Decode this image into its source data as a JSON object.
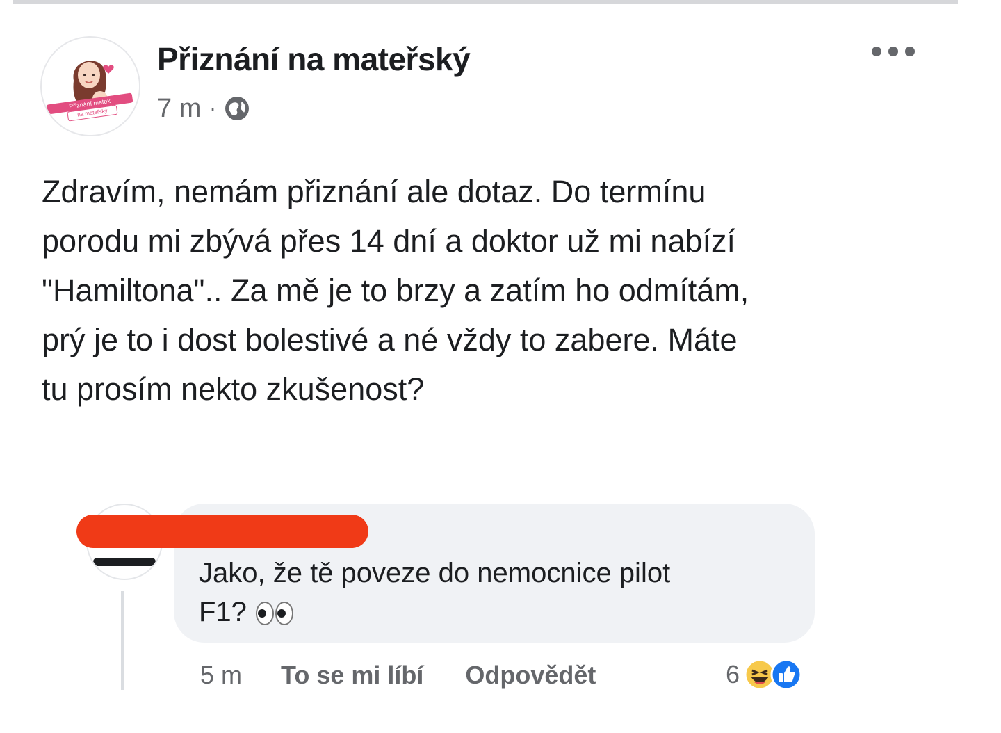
{
  "post": {
    "page_name": "Přiznání na mateřský",
    "time": "7 m",
    "separator": "·",
    "privacy_icon": "globe-icon",
    "more_icon": "more-options-icon",
    "avatar_logo_text": [
      "Přiznání matek",
      "na mateřský"
    ],
    "text_lines": [
      "Zdravím, nemám přiznání ale dotaz. Do termínu",
      "porodu mi zbývá přes 14 dní a doktor už mi nabízí",
      "\"Hamiltona\".. Za mě je to brzy a zatím ho odmítám,",
      "prý je to i dost bolestivé a né vždy to zabere. Máte",
      "tu prosím nekto zkušenost?"
    ]
  },
  "comment": {
    "text_lines": [
      "Jako, že tě poveze do nemocnice pilot",
      "F1?"
    ],
    "emoji_icon": "eyes-emoji-icon",
    "time": "5 m",
    "like_label": "To se mi líbí",
    "reply_label": "Odpovědět",
    "reaction_count": "6",
    "reaction_icons": [
      "laugh-reaction-icon",
      "like-reaction-icon"
    ]
  },
  "colors": {
    "text": "#1c1e21",
    "secondary": "#65676b",
    "bubble": "#f0f2f5",
    "redaction": "#f03a17",
    "like_blue": "#1877f2",
    "haha_yellow": "#f7c94b"
  }
}
